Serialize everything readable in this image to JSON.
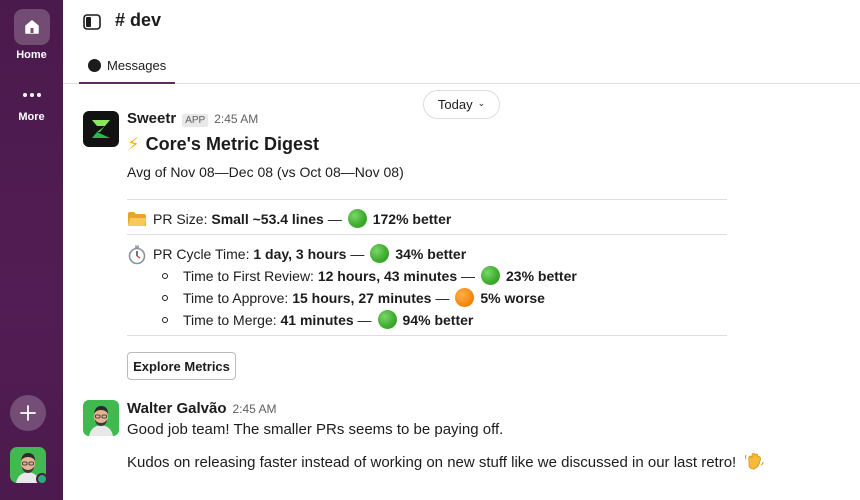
{
  "sidebar": {
    "home_label": "Home",
    "more_label": "More",
    "home_icon": "home-icon",
    "more_icon": "more-dots-icon",
    "add_icon": "plus-icon",
    "background_color": "#4a154b"
  },
  "header": {
    "channel": "# dev",
    "tab_label": "Messages",
    "tab_accent": "#5c2c5e"
  },
  "date_divider": {
    "label": "Today",
    "chevron": "chevron-down-icon"
  },
  "digest_message": {
    "sender": "Sweetr",
    "badge": "APP",
    "time": "2:45 AM",
    "title_emoji": "⚡",
    "title": "Core's Metric Digest",
    "subtitle": "Avg of Nov 08—Dec 08 (vs Oct 08—Nov 08)",
    "pr_size": {
      "label": "PR Size:",
      "value": "Small ~53.4 lines",
      "dash": "—",
      "status": "green",
      "change": "172% better"
    },
    "cycle_time": {
      "label": "PR Cycle Time:",
      "value": "1 day, 3 hours",
      "dash": "—",
      "status": "green",
      "change": "34% better"
    },
    "sub_metrics": [
      {
        "label": "Time to First Review:",
        "value": "12 hours, 43 minutes",
        "dash": "—",
        "status": "green",
        "change": "23% better"
      },
      {
        "label": "Time to Approve:",
        "value": "15 hours, 27 minutes",
        "dash": "—",
        "status": "orange",
        "change": "5% worse"
      },
      {
        "label": "Time to Merge:",
        "value": "41 minutes",
        "dash": "—",
        "status": "green",
        "change": "94% better"
      }
    ],
    "button_label": "Explore Metrics",
    "status_colors": {
      "green": "#3fae2f",
      "orange": "#f5890c"
    }
  },
  "reply_message": {
    "sender": "Walter Galvão",
    "time": "2:45 AM",
    "line1": "Good job team! The smaller PRs seems to be paying off.",
    "line2": "Kudos on releasing faster instead of working on new stuff like we discussed in our last retro!",
    "line2_emoji": "waving-hand-icon"
  }
}
